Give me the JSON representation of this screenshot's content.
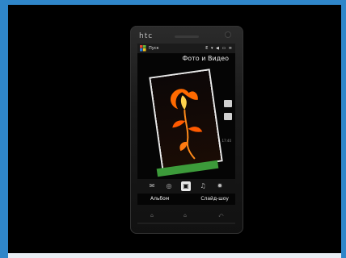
{
  "device": {
    "brand": "htc"
  },
  "status": {
    "start_label": "Пуск",
    "icons": "E ▾ ◀ ▭ ≡"
  },
  "app": {
    "title": "Фото и Видео",
    "time_label": "17:40"
  },
  "softkeys": {
    "left": "Альбом",
    "right": "Слайд-шоу"
  },
  "icons": {
    "tabs": [
      "mail-icon",
      "globe-icon",
      "camera-icon",
      "music-icon",
      "settings-icon"
    ],
    "tab_glyphs": [
      "✉",
      "◎",
      "▣",
      "♫",
      "✹"
    ],
    "hw_glyphs": [
      "⌂",
      "⌂",
      "⤺"
    ]
  },
  "colors": {
    "accent": "#2f86c9",
    "flame": "#ff6a00",
    "leaf_green": "#3c9a3a"
  }
}
